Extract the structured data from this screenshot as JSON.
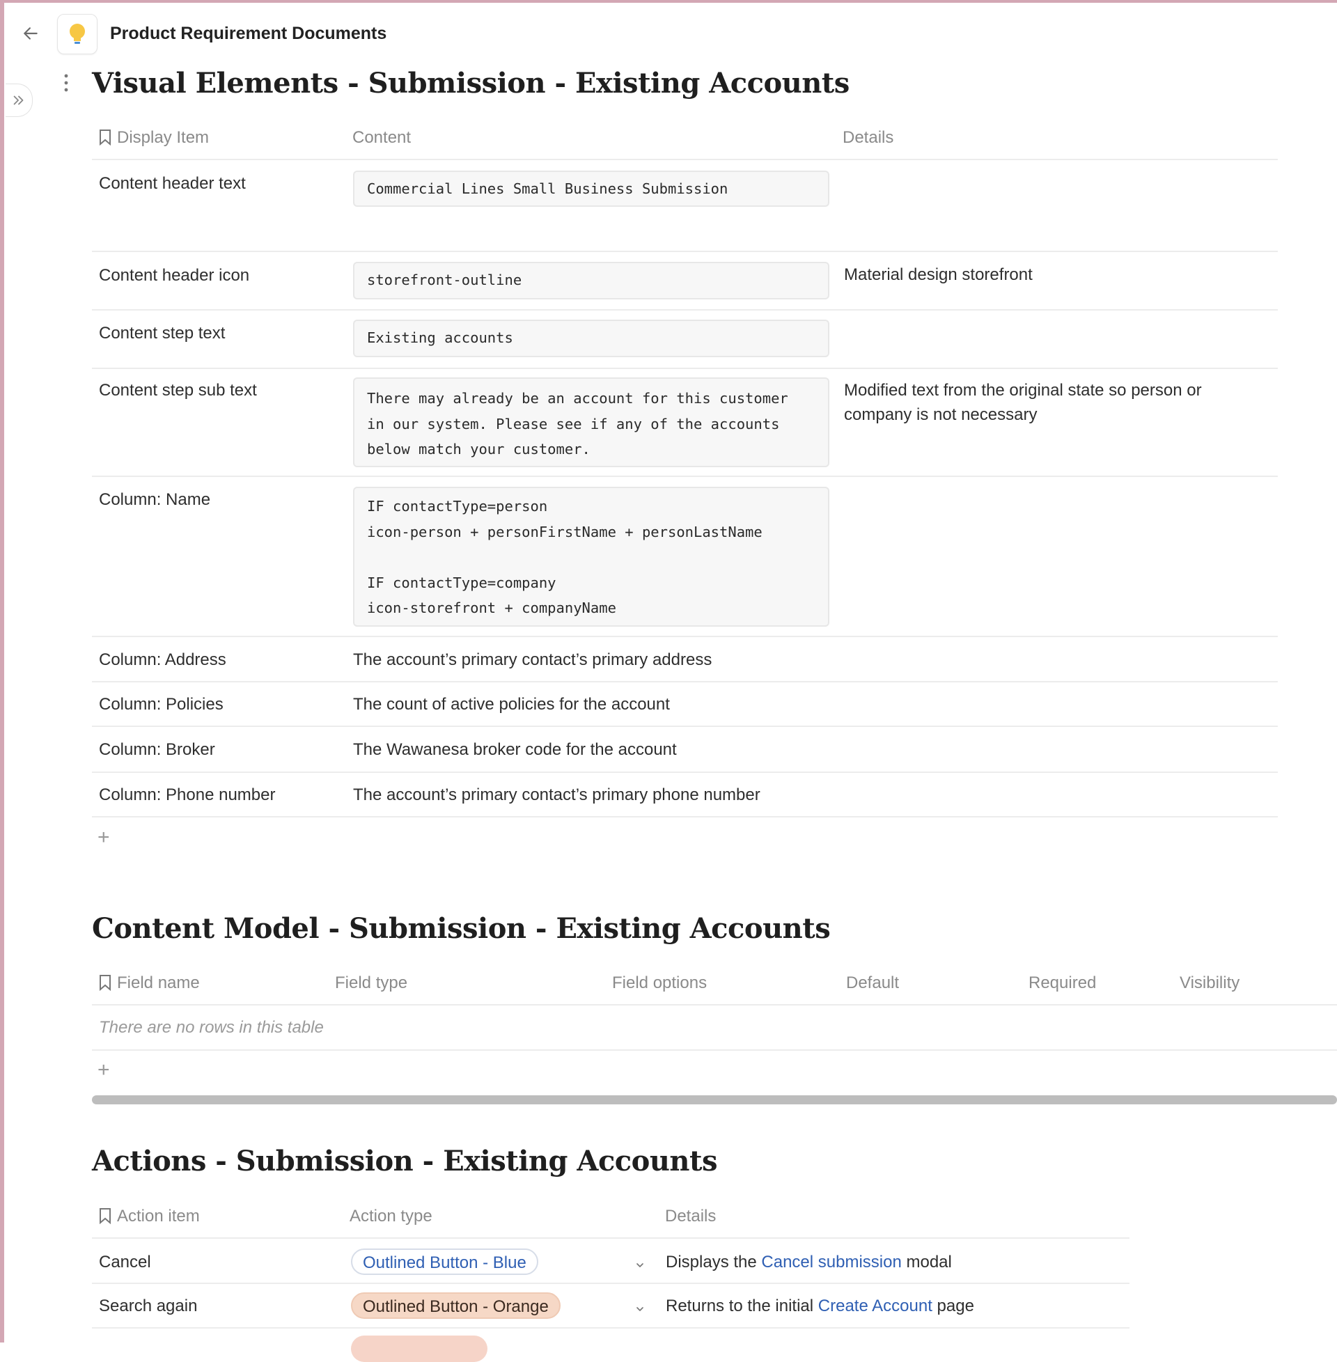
{
  "header": {
    "doc_title": "Product Requirement Documents"
  },
  "visual_elements": {
    "title": "Visual Elements - Submission - Existing Accounts",
    "columns": [
      "Display Item",
      "Content",
      "Details"
    ],
    "rows": [
      {
        "item": "Content header text",
        "content": "Commercial Lines Small Business Submission",
        "details": ""
      },
      {
        "item": "Content header icon",
        "content": "storefront-outline",
        "details": "Material design storefront"
      },
      {
        "item": "Content step text",
        "content": "Existing accounts",
        "details": ""
      },
      {
        "item": "Content step sub text",
        "content": "There may already be an account for this customer\nin our system. Please see if any of the accounts\nbelow match your customer.",
        "details": "Modified text from the original state so person or company is not necessary"
      },
      {
        "item": "Column: Name",
        "content": "IF contactType=person\nicon-person + personFirstName + personLastName\n\nIF contactType=company\nicon-storefront + companyName",
        "details": ""
      },
      {
        "item": "Column: Address",
        "content": "The account’s primary contact’s primary address",
        "details": ""
      },
      {
        "item": "Column: Policies",
        "content": "The count of active policies for the account",
        "details": ""
      },
      {
        "item": "Column: Broker",
        "content": "The Wawanesa broker code for the account",
        "details": ""
      },
      {
        "item": "Column: Phone number",
        "content": "The account’s primary contact’s primary phone number",
        "details": ""
      }
    ],
    "add_row": "+"
  },
  "content_model": {
    "title": "Content Model - Submission - Existing Accounts",
    "columns": [
      "Field name",
      "Field type",
      "Field options",
      "Default",
      "Required",
      "Visibility"
    ],
    "empty_text": "There are no rows in this table",
    "add_row": "+"
  },
  "actions": {
    "title": "Actions - Submission - Existing Accounts",
    "columns": [
      "Action item",
      "Action type",
      "Details"
    ],
    "rows": [
      {
        "item": "Cancel",
        "type": "Outlined Button - Blue",
        "details_before": "Displays the ",
        "details_link": "Cancel submission",
        "details_after": " modal"
      },
      {
        "item": "Search again",
        "type": "Outlined Button - Orange",
        "details_before": "Returns to the initial ",
        "details_link": "Create Account",
        "details_after": " page"
      }
    ]
  },
  "colors": {
    "accent_link": "#2f5fb3",
    "frame": "#d3a7b4",
    "pill_orange": "#f6d8c6"
  },
  "icons": [
    "back-arrow-icon",
    "lightbulb-icon",
    "double-chevron-right-icon",
    "kebab-icon",
    "bookmark-icon",
    "chevron-down-icon"
  ]
}
